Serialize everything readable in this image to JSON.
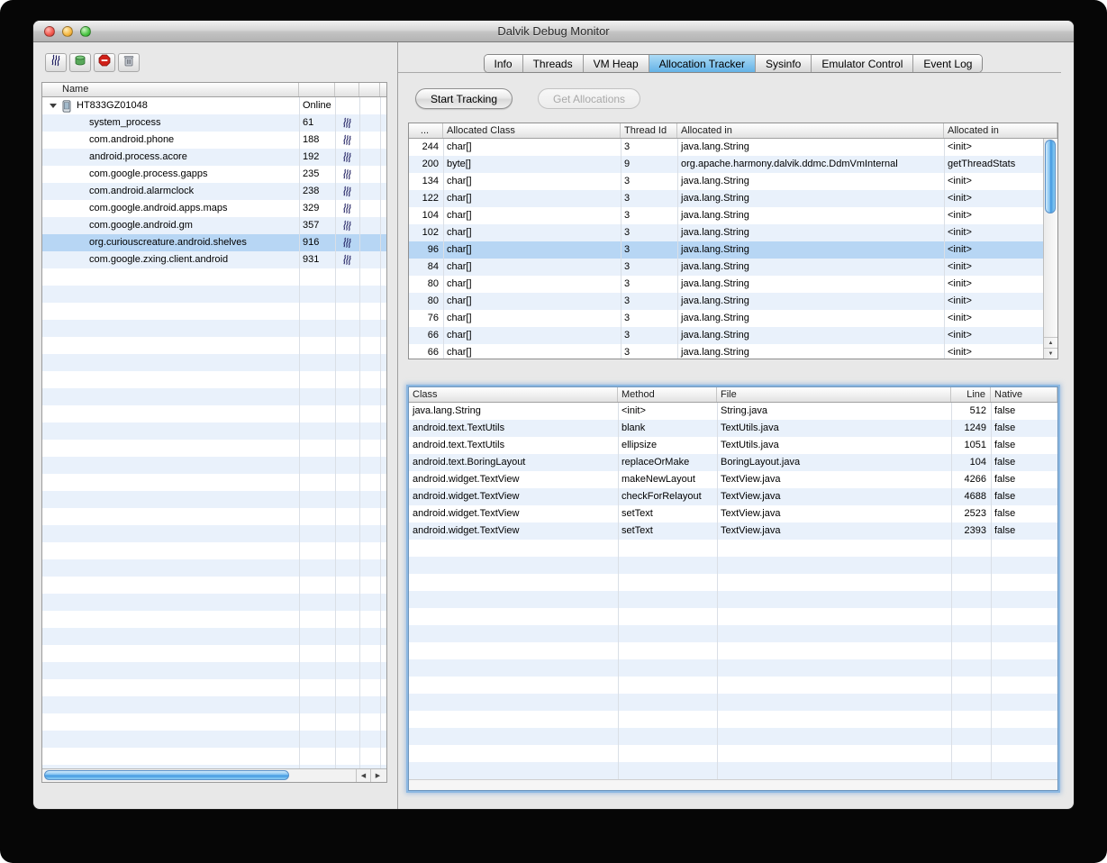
{
  "window": {
    "title": "Dalvik Debug Monitor"
  },
  "toolbar": {
    "icons": [
      "thread-updates-icon",
      "update-heap-icon",
      "halt-process-icon",
      "cause-gc-icon"
    ]
  },
  "device_panel": {
    "name_header": "Name",
    "device": {
      "name": "HT833GZ01048",
      "status": "Online"
    },
    "processes": [
      {
        "name": "system_process",
        "pid": "61",
        "selected": false
      },
      {
        "name": "com.android.phone",
        "pid": "188",
        "selected": false
      },
      {
        "name": "android.process.acore",
        "pid": "192",
        "selected": false
      },
      {
        "name": "com.google.process.gapps",
        "pid": "235",
        "selected": false
      },
      {
        "name": "com.android.alarmclock",
        "pid": "238",
        "selected": false
      },
      {
        "name": "com.google.android.apps.maps",
        "pid": "329",
        "selected": false
      },
      {
        "name": "com.google.android.gm",
        "pid": "357",
        "selected": false
      },
      {
        "name": "org.curiouscreature.android.shelves",
        "pid": "916",
        "selected": true
      },
      {
        "name": "com.google.zxing.client.android",
        "pid": "931",
        "selected": false
      }
    ]
  },
  "tabs": [
    {
      "label": "Info",
      "selected": false
    },
    {
      "label": "Threads",
      "selected": false
    },
    {
      "label": "VM Heap",
      "selected": false
    },
    {
      "label": "Allocation Tracker",
      "selected": true
    },
    {
      "label": "Sysinfo",
      "selected": false
    },
    {
      "label": "Emulator Control",
      "selected": false
    },
    {
      "label": "Event Log",
      "selected": false
    }
  ],
  "actions": {
    "start_tracking": "Start Tracking",
    "get_allocations": "Get Allocations"
  },
  "allocations": {
    "columns": [
      "...",
      "Allocated Class",
      "Thread Id",
      "Allocated in",
      "Allocated in"
    ],
    "rows": [
      {
        "size": "244",
        "allocated_class": "char[]",
        "thread_id": "3",
        "in_class": "java.lang.String",
        "in_method": "<init>",
        "selected": false
      },
      {
        "size": "200",
        "allocated_class": "byte[]",
        "thread_id": "9",
        "in_class": "org.apache.harmony.dalvik.ddmc.DdmVmInternal",
        "in_method": "getThreadStats",
        "selected": false
      },
      {
        "size": "134",
        "allocated_class": "char[]",
        "thread_id": "3",
        "in_class": "java.lang.String",
        "in_method": "<init>",
        "selected": false
      },
      {
        "size": "122",
        "allocated_class": "char[]",
        "thread_id": "3",
        "in_class": "java.lang.String",
        "in_method": "<init>",
        "selected": false
      },
      {
        "size": "104",
        "allocated_class": "char[]",
        "thread_id": "3",
        "in_class": "java.lang.String",
        "in_method": "<init>",
        "selected": false
      },
      {
        "size": "102",
        "allocated_class": "char[]",
        "thread_id": "3",
        "in_class": "java.lang.String",
        "in_method": "<init>",
        "selected": false
      },
      {
        "size": "96",
        "allocated_class": "char[]",
        "thread_id": "3",
        "in_class": "java.lang.String",
        "in_method": "<init>",
        "selected": true
      },
      {
        "size": "84",
        "allocated_class": "char[]",
        "thread_id": "3",
        "in_class": "java.lang.String",
        "in_method": "<init>",
        "selected": false
      },
      {
        "size": "80",
        "allocated_class": "char[]",
        "thread_id": "3",
        "in_class": "java.lang.String",
        "in_method": "<init>",
        "selected": false
      },
      {
        "size": "80",
        "allocated_class": "char[]",
        "thread_id": "3",
        "in_class": "java.lang.String",
        "in_method": "<init>",
        "selected": false
      },
      {
        "size": "76",
        "allocated_class": "char[]",
        "thread_id": "3",
        "in_class": "java.lang.String",
        "in_method": "<init>",
        "selected": false
      },
      {
        "size": "66",
        "allocated_class": "char[]",
        "thread_id": "3",
        "in_class": "java.lang.String",
        "in_method": "<init>",
        "selected": false
      },
      {
        "size": "66",
        "allocated_class": "char[]",
        "thread_id": "3",
        "in_class": "java.lang.String",
        "in_method": "<init>",
        "selected": false
      }
    ]
  },
  "stack_trace": {
    "columns": [
      "Class",
      "Method",
      "File",
      "Line",
      "Native"
    ],
    "rows": [
      {
        "class": "java.lang.String",
        "method": "<init>",
        "file": "String.java",
        "line": "512",
        "native": "false"
      },
      {
        "class": "android.text.TextUtils",
        "method": "blank",
        "file": "TextUtils.java",
        "line": "1249",
        "native": "false"
      },
      {
        "class": "android.text.TextUtils",
        "method": "ellipsize",
        "file": "TextUtils.java",
        "line": "1051",
        "native": "false"
      },
      {
        "class": "android.text.BoringLayout",
        "method": "replaceOrMake",
        "file": "BoringLayout.java",
        "line": "104",
        "native": "false"
      },
      {
        "class": "android.widget.TextView",
        "method": "makeNewLayout",
        "file": "TextView.java",
        "line": "4266",
        "native": "false"
      },
      {
        "class": "android.widget.TextView",
        "method": "checkForRelayout",
        "file": "TextView.java",
        "line": "4688",
        "native": "false"
      },
      {
        "class": "android.widget.TextView",
        "method": "setText",
        "file": "TextView.java",
        "line": "2523",
        "native": "false"
      },
      {
        "class": "android.widget.TextView",
        "method": "setText",
        "file": "TextView.java",
        "line": "2393",
        "native": "false"
      }
    ]
  },
  "colors": {
    "selection": "#b7d6f4",
    "row_stripe": "#e9f1fb",
    "tab_selected": "#7dc0ea",
    "scrollbar_thumb": "#5aa7e8"
  }
}
